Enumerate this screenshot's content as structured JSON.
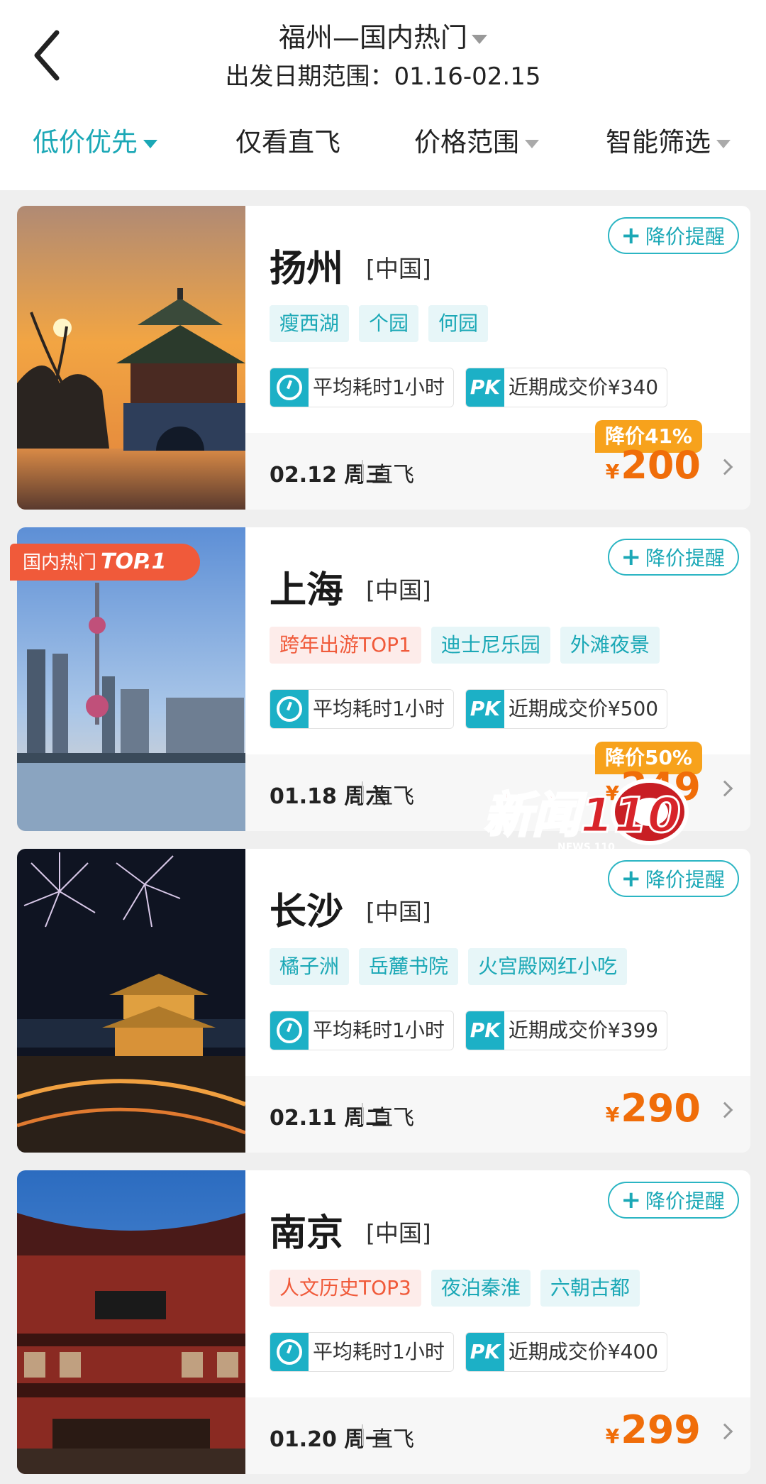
{
  "header": {
    "route": "福州—国内热门",
    "date_range": "出发日期范围：01.16-02.15"
  },
  "filters": [
    {
      "label": "低价优先",
      "active": true
    },
    {
      "label": "仅看直飞",
      "active": false
    },
    {
      "label": "价格范围",
      "active": false
    },
    {
      "label": "智能筛选",
      "active": false
    }
  ],
  "alert_label": "降价提醒",
  "cards": [
    {
      "city": "扬州",
      "country": "[中国]",
      "tags": [
        {
          "text": "瘦西湖"
        },
        {
          "text": "个园"
        },
        {
          "text": "何园"
        }
      ],
      "avg_time": "平均耗时1小时",
      "pk_label": "PK",
      "recent_price": "近期成交价¥340",
      "date": "02.12 周三",
      "flight_type": "直飞",
      "currency": "¥",
      "price": "200",
      "discount": "降价41%"
    },
    {
      "city": "上海",
      "country": "[中国]",
      "rank_badge": {
        "text": "国内热门",
        "rank": "TOP.1"
      },
      "tags": [
        {
          "text": "跨年出游TOP1",
          "hot": true
        },
        {
          "text": "迪士尼乐园"
        },
        {
          "text": "外滩夜景"
        }
      ],
      "avg_time": "平均耗时1小时",
      "pk_label": "PK",
      "recent_price": "近期成交价¥500",
      "date": "01.18 周六",
      "flight_type": "直飞",
      "currency": "¥",
      "price": "249",
      "discount": "降价50%"
    },
    {
      "city": "长沙",
      "country": "[中国]",
      "tags": [
        {
          "text": "橘子洲"
        },
        {
          "text": "岳麓书院"
        },
        {
          "text": "火宫殿网红小吃"
        }
      ],
      "avg_time": "平均耗时1小时",
      "pk_label": "PK",
      "recent_price": "近期成交价¥399",
      "date": "02.11 周二",
      "flight_type": "直飞",
      "currency": "¥",
      "price": "290"
    },
    {
      "city": "南京",
      "country": "[中国]",
      "tags": [
        {
          "text": "人文历史TOP3",
          "hot": true
        },
        {
          "text": "夜泊秦淮"
        },
        {
          "text": "六朝古都"
        }
      ],
      "avg_time": "平均耗时1小时",
      "pk_label": "PK",
      "recent_price": "近期成交价¥400",
      "date": "01.20 周一",
      "flight_type": "直飞",
      "currency": "¥",
      "price": "299"
    }
  ],
  "watermark": {
    "title": "新闻110",
    "sub": "NEWS 110"
  },
  "colors": {
    "accent": "#1ba8b6",
    "price": "#f06d09",
    "discount": "#f7a21c",
    "hot": "#f05a3a"
  }
}
